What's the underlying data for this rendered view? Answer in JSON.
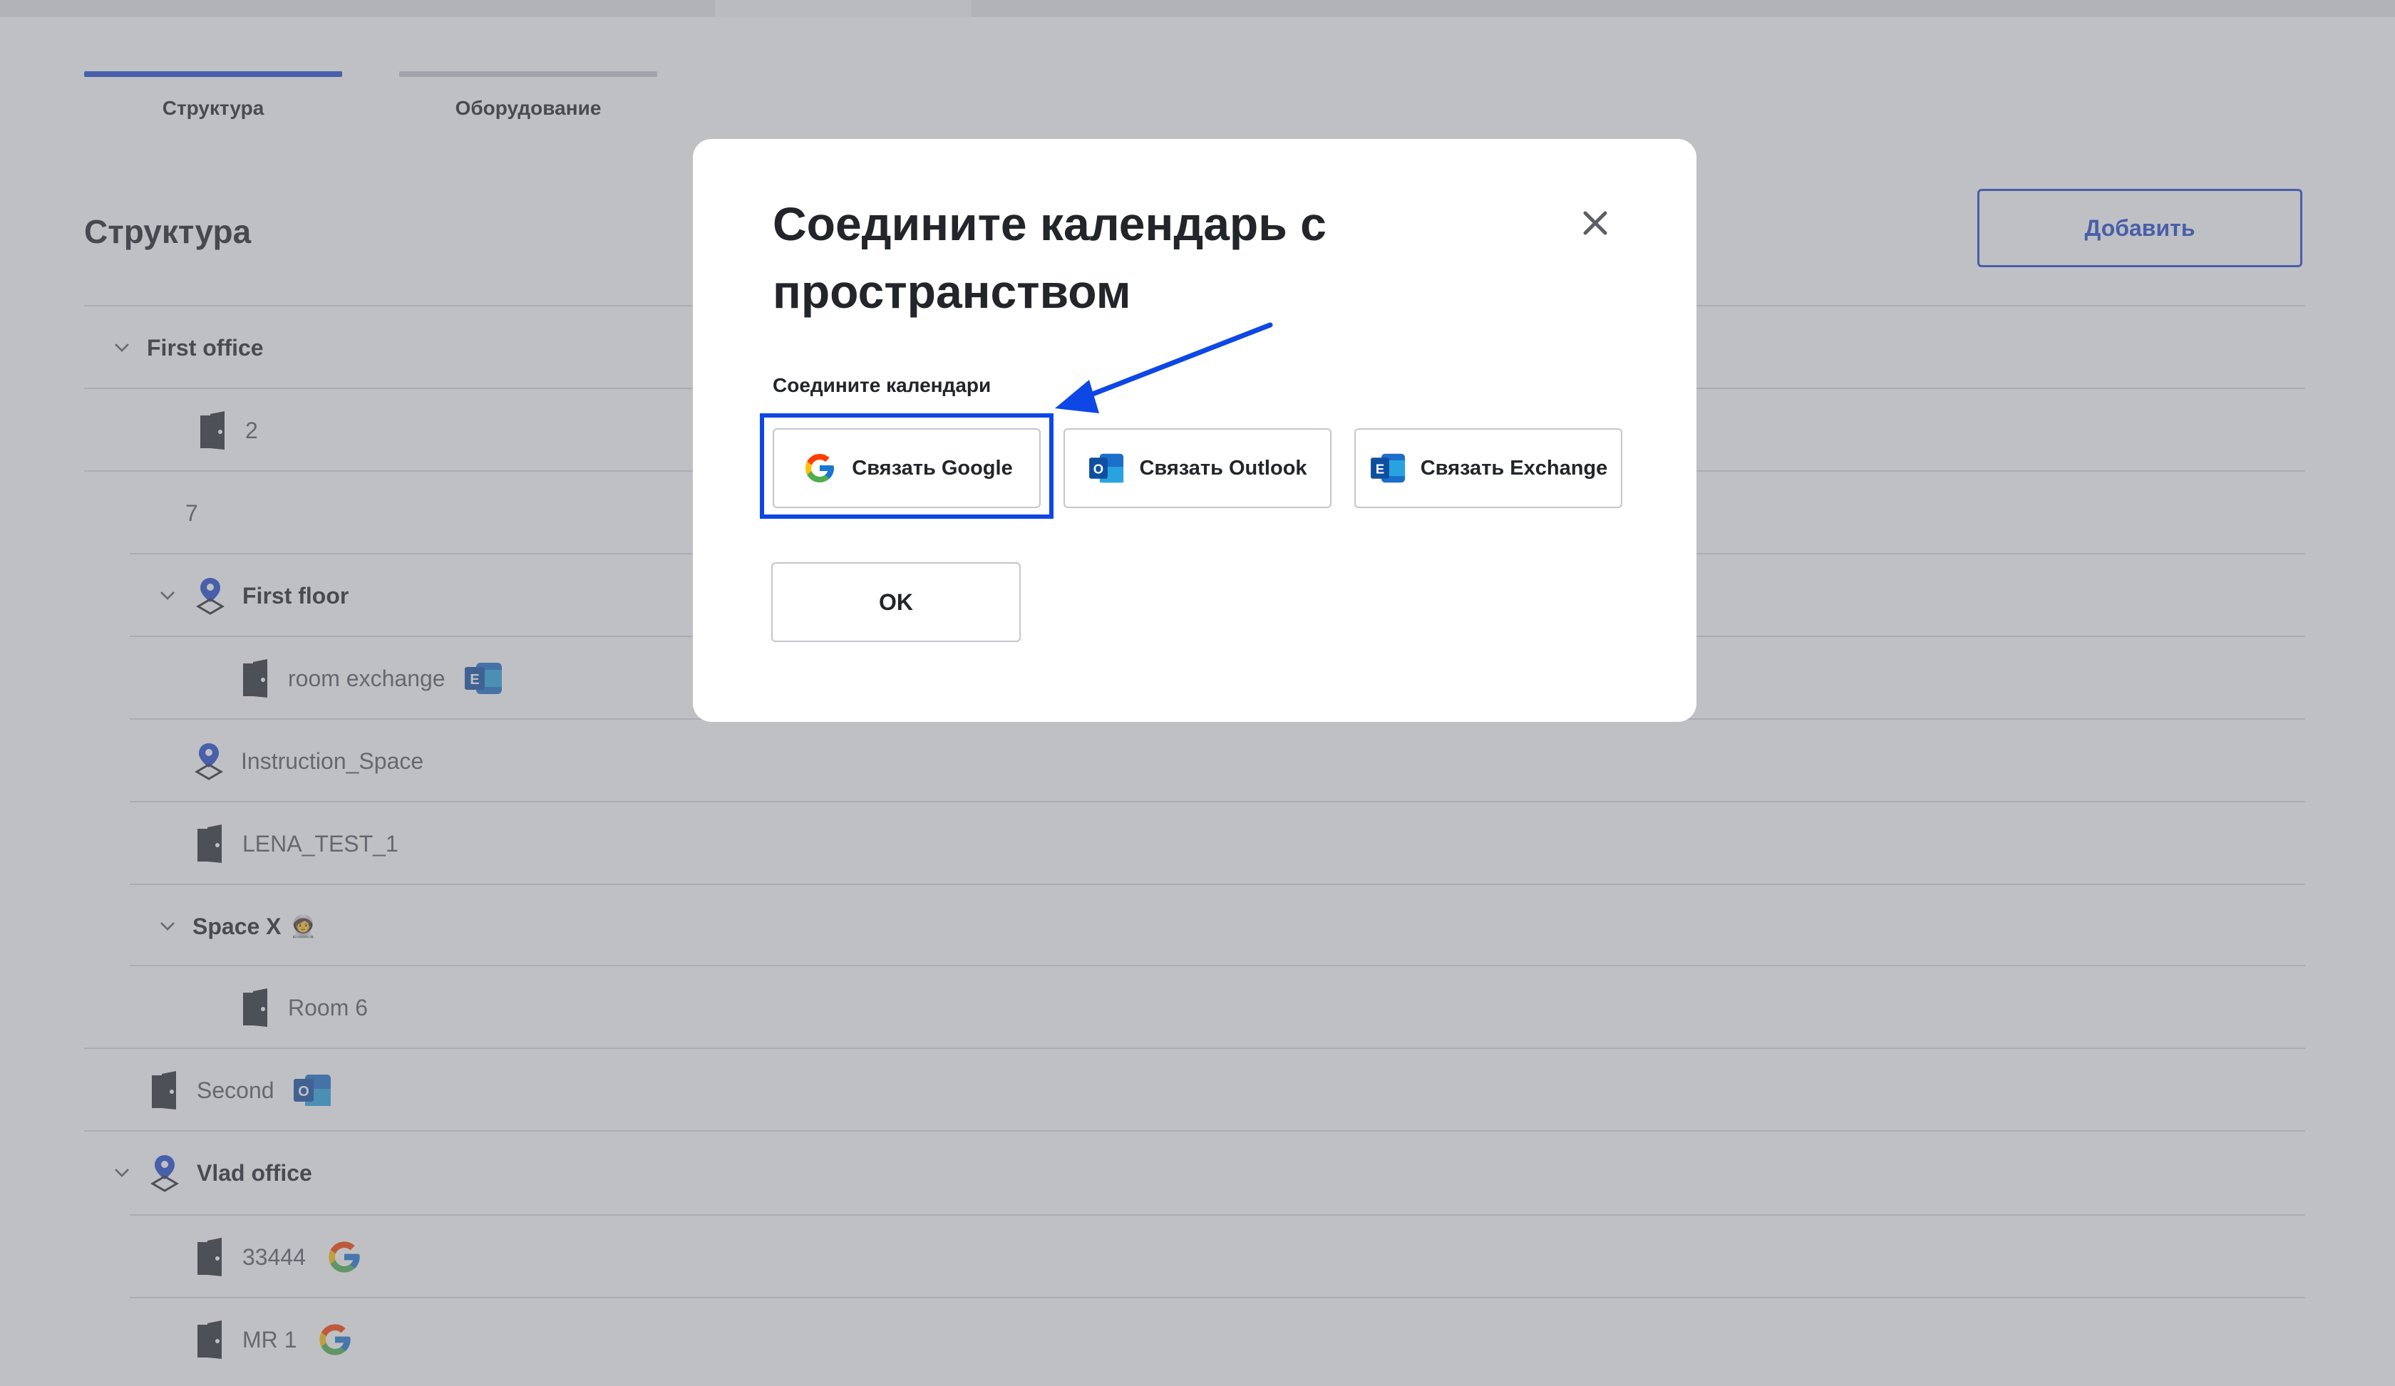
{
  "tabs": [
    {
      "label": "Структура",
      "active": true
    },
    {
      "label": "Оборудование",
      "active": false
    }
  ],
  "page": {
    "title": "Структура",
    "add_button": "Добавить"
  },
  "tree": [
    {
      "label": "First office",
      "bold": true,
      "icon": "chevron-down-icon"
    },
    {
      "label": "2",
      "bold": false,
      "icon": "door-icon"
    },
    {
      "label": "7",
      "bold": false,
      "icon": ""
    },
    {
      "label": "First floor",
      "bold": true,
      "icon": "location-pin-icon"
    },
    {
      "label": "room exchange",
      "bold": false,
      "icon": "door-icon",
      "calendar": "exchange-icon"
    },
    {
      "label": "Instruction_Space",
      "bold": false,
      "icon": "location-pin-icon"
    },
    {
      "label": "LENA_TEST_1",
      "bold": false,
      "icon": "door-icon"
    },
    {
      "label": "Space X",
      "bold": true,
      "icon": "chevron-down-icon",
      "emoji": "🧑‍🚀"
    },
    {
      "label": "Room 6",
      "bold": false,
      "icon": "door-icon"
    },
    {
      "label": "Second",
      "bold": false,
      "icon": "door-icon",
      "calendar": "outlook-icon"
    },
    {
      "label": "Vlad office",
      "bold": true,
      "icon": "location-pin-icon"
    },
    {
      "label": "33444",
      "bold": false,
      "icon": "door-icon",
      "calendar": "google-icon"
    },
    {
      "label": "MR 1",
      "bold": false,
      "icon": "door-icon",
      "calendar": "google-icon"
    }
  ],
  "modal": {
    "title": "Соедините календарь с пространством",
    "subtitle": "Соедините календари",
    "buttons": {
      "google": "Связать Google",
      "outlook": "Связать Outlook",
      "exchange": "Связать Exchange"
    },
    "ok": "OK"
  },
  "colors": {
    "accent": "#1f48cf",
    "highlight": "#0d47e6",
    "overlay": "#767a82"
  }
}
